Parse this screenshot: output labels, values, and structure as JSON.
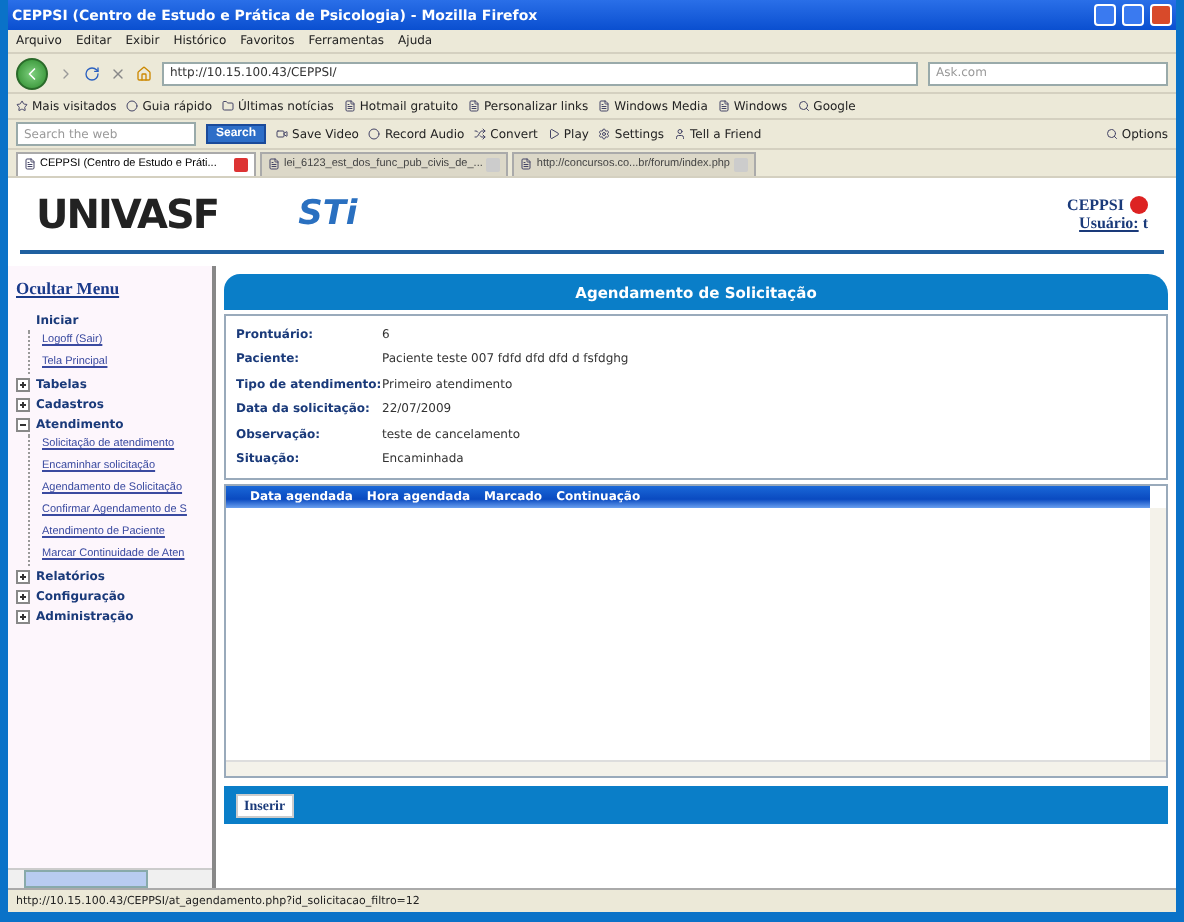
{
  "window": {
    "title": "CEPPSI (Centro de Estudo e Prática de Psicologia) - Mozilla Firefox"
  },
  "menu": [
    "Arquivo",
    "Editar",
    "Exibir",
    "Histórico",
    "Favoritos",
    "Ferramentas",
    "Ajuda"
  ],
  "nav": {
    "url": "http://10.15.100.43/CEPPSI/",
    "search_placeholder": "Ask.com"
  },
  "bookmarks": [
    "Mais visitados",
    "Guia rápido",
    "Últimas notícias",
    "Hotmail gratuito",
    "Personalizar links",
    "Windows Media",
    "Windows",
    "Google"
  ],
  "ask_toolbar": {
    "search_placeholder": "Search the web",
    "search_button": "Search",
    "items": [
      "Save Video",
      "Record Audio",
      "Convert",
      "Play",
      "Settings",
      "Tell a Friend"
    ],
    "options": "Options"
  },
  "tabs": [
    {
      "label": "CEPPSI (Centro de Estudo e Práti...",
      "selected": true
    },
    {
      "label": "lei_6123_est_dos_func_pub_civis_de_...",
      "selected": false
    },
    {
      "label": "http://concursos.co...br/forum/index.php",
      "selected": false
    }
  ],
  "header": {
    "logo_left": "UNIVASF",
    "logo_right": "STi",
    "org": "CEPPSI",
    "user_label": "Usuário:",
    "user": "t"
  },
  "sidebar": {
    "toggle": "Ocultar Menu",
    "tree": [
      {
        "label": "Iniciar",
        "kind": "root",
        "children": [
          {
            "label": "Logoff (Sair)"
          },
          {
            "label": "Tela Principal"
          }
        ]
      },
      {
        "label": "Tabelas",
        "kind": "folder",
        "expanded": false
      },
      {
        "label": "Cadastros",
        "kind": "folder",
        "expanded": false
      },
      {
        "label": "Atendimento",
        "kind": "folder",
        "expanded": true,
        "children": [
          {
            "label": "Solicitação de atendimento"
          },
          {
            "label": "Encaminhar solicitação"
          },
          {
            "label": "Agendamento de Solicitação"
          },
          {
            "label": "Confirmar Agendamento de S"
          },
          {
            "label": "Atendimento de Paciente"
          },
          {
            "label": "Marcar Continuidade de Aten"
          }
        ]
      },
      {
        "label": "Relatórios",
        "kind": "folder",
        "expanded": false
      },
      {
        "label": "Configuração",
        "kind": "folder",
        "expanded": false
      },
      {
        "label": "Administração",
        "kind": "folder",
        "expanded": false
      }
    ]
  },
  "panel": {
    "title": "Agendamento de Solicitação",
    "fields": [
      {
        "label": "Prontuário:",
        "value": "6"
      },
      {
        "label": "Paciente:",
        "value": "Paciente teste 007 fdfd dfd dfd d fsfdghg"
      },
      {
        "label": "Tipo de atendimento:",
        "value": "Primeiro atendimento"
      },
      {
        "label": "Data da solicitação:",
        "value": "22/07/2009"
      },
      {
        "label": "Observação:",
        "value": "teste de cancelamento"
      },
      {
        "label": "Situação:",
        "value": "Encaminhada"
      }
    ],
    "grid_columns": [
      "Data agendada",
      "Hora agendada",
      "Marcado",
      "Continuação"
    ],
    "button": "Inserir"
  },
  "status_bar": "http://10.15.100.43/CEPPSI/at_agendamento.php?id_solicitacao_filtro=12"
}
